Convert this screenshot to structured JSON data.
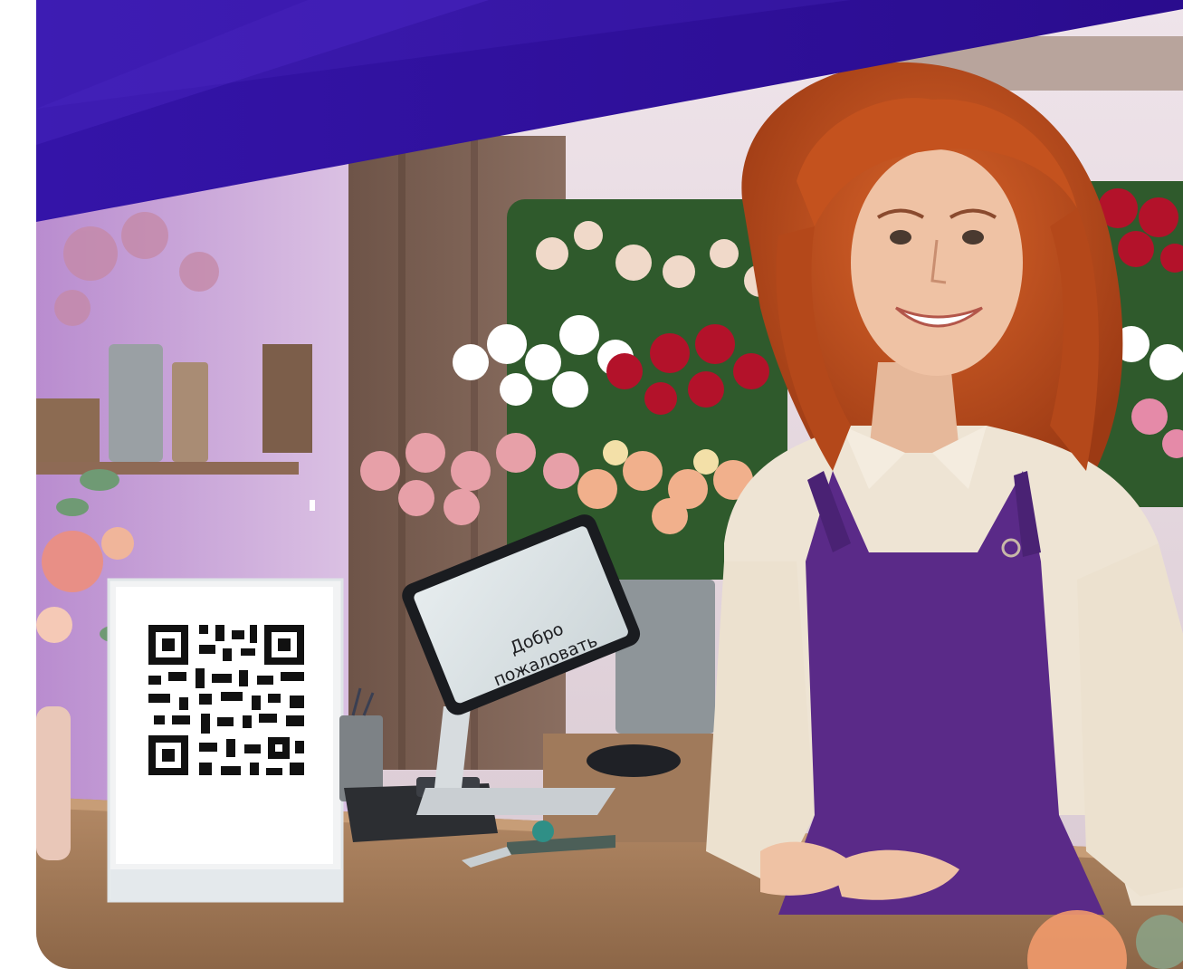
{
  "banner": {
    "gradient_start": "#2a0fa0",
    "gradient_end": "#4a1fb8"
  },
  "pos_screen": {
    "text_line1": "Добро",
    "text_line2": "пожаловать"
  },
  "qr_sign": {
    "icon": "qr-code-icon"
  },
  "palette": {
    "wall_left": "#c9a2d8",
    "wall_back": "#e6d8e2",
    "counter": "#a67c5b",
    "apron": "#5a2d86",
    "hair": "#c4521e",
    "shirt": "#efe6d8"
  }
}
